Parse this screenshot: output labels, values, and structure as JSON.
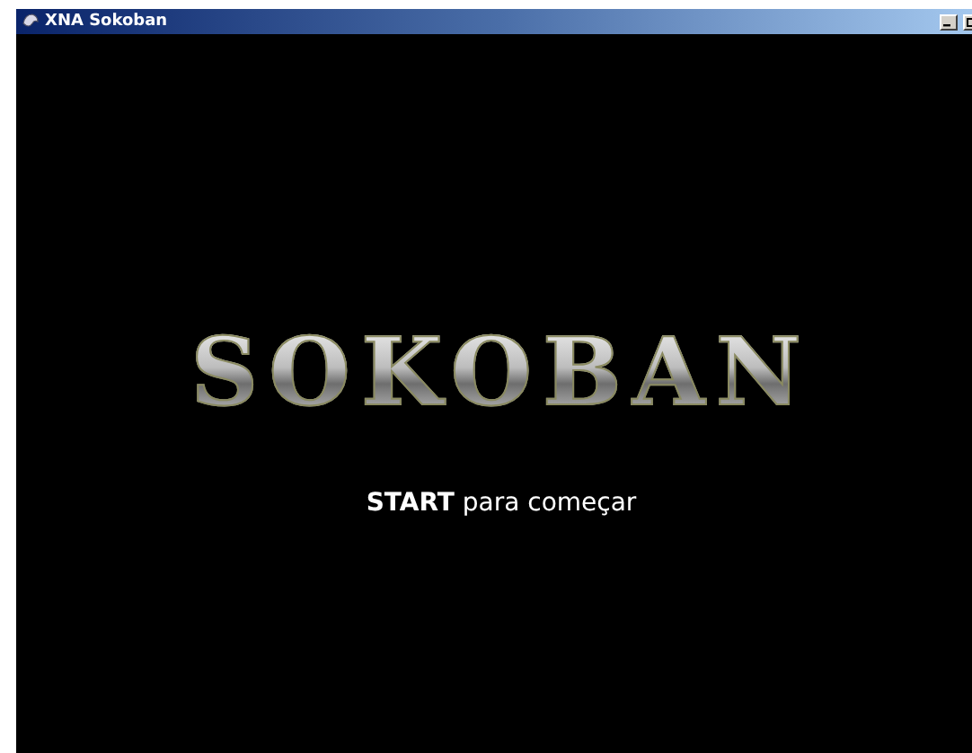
{
  "window": {
    "title": "XNA Sokoban"
  },
  "logo": "SOKOBAN",
  "prompt": "**START** para começar"
}
